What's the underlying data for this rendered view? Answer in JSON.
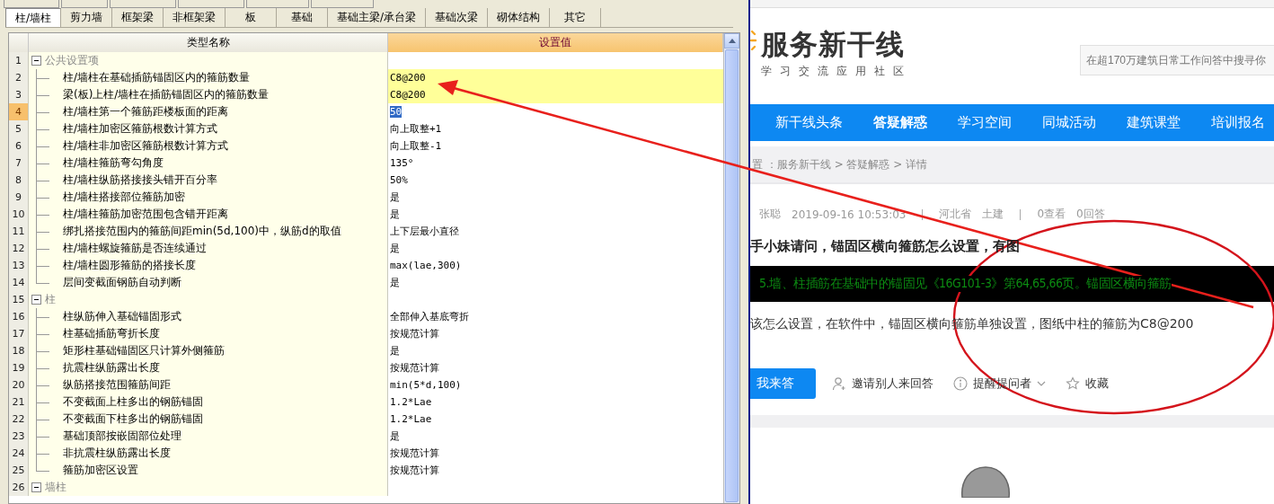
{
  "settings_panel": {
    "category_tabs": [
      {
        "label": "柱/墙柱",
        "selected": true
      },
      {
        "label": "剪力墙",
        "selected": false
      },
      {
        "label": "框架梁",
        "selected": false
      },
      {
        "label": "非框架梁",
        "selected": false
      },
      {
        "label": "板",
        "selected": false
      },
      {
        "label": "基础",
        "selected": false
      },
      {
        "label": "基础主梁/承台梁",
        "selected": false
      },
      {
        "label": "基础次梁",
        "selected": false
      },
      {
        "label": "砌体结构",
        "selected": false
      },
      {
        "label": "其它",
        "selected": false
      }
    ],
    "table": {
      "columns": [
        "类型名称",
        "设置值"
      ],
      "rows": [
        {
          "number": "1",
          "kind": "group",
          "name": "公共设置项",
          "expanded": true,
          "selected": false
        },
        {
          "number": "2",
          "kind": "item",
          "name": "柱/墙柱在基础插筋锚固区内的箍筋数量",
          "value": "C8@200",
          "selected": false,
          "highlighted": true
        },
        {
          "number": "3",
          "kind": "item",
          "name": "梁(板)上柱/墙柱在插筋锚固区内的箍筋数量",
          "value": "C8@200",
          "selected": false,
          "highlighted": true
        },
        {
          "number": "4",
          "kind": "item",
          "name": "柱/墙柱第一个箍筋距楼板面的距离",
          "value": "50",
          "selected": true,
          "highlighted": false
        },
        {
          "number": "5",
          "kind": "item",
          "name": "柱/墙柱加密区箍筋根数计算方式",
          "value": "向上取整+1",
          "selected": false,
          "highlighted": false
        },
        {
          "number": "6",
          "kind": "item",
          "name": "柱/墙柱非加密区箍筋根数计算方式",
          "value": "向上取整-1",
          "selected": false,
          "highlighted": false
        },
        {
          "number": "7",
          "kind": "item",
          "name": "柱/墙柱箍筋弯勾角度",
          "value": "135°",
          "selected": false,
          "highlighted": false
        },
        {
          "number": "8",
          "kind": "item",
          "name": "柱/墙柱纵筋搭接接头错开百分率",
          "value": "50%",
          "selected": false,
          "highlighted": false
        },
        {
          "number": "9",
          "kind": "item",
          "name": "柱/墙柱搭接部位箍筋加密",
          "value": "是",
          "selected": false,
          "highlighted": false
        },
        {
          "number": "10",
          "kind": "item",
          "name": "柱/墙柱箍筋加密范围包含错开距离",
          "value": "是",
          "selected": false,
          "highlighted": false
        },
        {
          "number": "11",
          "kind": "item",
          "name": "绑扎搭接范围内的箍筋间距min(5d,100)中，纵筋d的取值",
          "value": "上下层最小直径",
          "selected": false,
          "highlighted": false
        },
        {
          "number": "12",
          "kind": "item",
          "name": "柱/墙柱螺旋箍筋是否连续通过",
          "value": "是",
          "selected": false,
          "highlighted": false
        },
        {
          "number": "13",
          "kind": "item",
          "name": "柱/墙柱圆形箍筋的搭接长度",
          "value": "max(lae,300)",
          "selected": false,
          "highlighted": false
        },
        {
          "number": "14",
          "kind": "item",
          "name": "层间变截面钢筋自动判断",
          "value": "是",
          "selected": false,
          "highlighted": false
        },
        {
          "number": "15",
          "kind": "group",
          "name": "柱",
          "expanded": true,
          "selected": false
        },
        {
          "number": "16",
          "kind": "item",
          "name": "柱纵筋伸入基础锚固形式",
          "value": "全部伸入基底弯折",
          "selected": false,
          "highlighted": false
        },
        {
          "number": "17",
          "kind": "item",
          "name": "柱基础插筋弯折长度",
          "value": "按规范计算",
          "selected": false,
          "highlighted": false
        },
        {
          "number": "18",
          "kind": "item",
          "name": "矩形柱基础锚固区只计算外侧箍筋",
          "value": "是",
          "selected": false,
          "highlighted": false
        },
        {
          "number": "19",
          "kind": "item",
          "name": "抗震柱纵筋露出长度",
          "value": "按规范计算",
          "selected": false,
          "highlighted": false
        },
        {
          "number": "20",
          "kind": "item",
          "name": "纵筋搭接范围箍筋间距",
          "value": "min(5*d,100)",
          "selected": false,
          "highlighted": false
        },
        {
          "number": "21",
          "kind": "item",
          "name": "不变截面上柱多出的钢筋锚固",
          "value": "1.2*Lae",
          "selected": false,
          "highlighted": false
        },
        {
          "number": "22",
          "kind": "item",
          "name": "不变截面下柱多出的钢筋锚固",
          "value": "1.2*Lae",
          "selected": false,
          "highlighted": false
        },
        {
          "number": "23",
          "kind": "item",
          "name": "基础顶部按嵌固部位处理",
          "value": "是",
          "selected": false,
          "highlighted": false
        },
        {
          "number": "24",
          "kind": "item",
          "name": "非抗震柱纵筋露出长度",
          "value": "按规范计算",
          "selected": false,
          "highlighted": false
        },
        {
          "number": "25",
          "kind": "item",
          "name": "箍筋加密区设置",
          "value": "按规范计算",
          "selected": false,
          "highlighted": false
        },
        {
          "number": "26",
          "kind": "group",
          "name": "墙柱",
          "expanded": true,
          "selected": false
        }
      ]
    }
  },
  "browser": {
    "logo": {
      "title": "服务新干线",
      "subtitle": "学习交流应用社区"
    },
    "search": {
      "placeholder": "在超170万建筑日常工作问答中搜寻你"
    },
    "nav": [
      {
        "label": "新干线头条",
        "selected": false
      },
      {
        "label": "答疑解惑",
        "selected": true
      },
      {
        "label": "学习空间",
        "selected": false
      },
      {
        "label": "同城活动",
        "selected": false
      },
      {
        "label": "建筑课堂",
        "selected": false
      },
      {
        "label": "培训报名",
        "selected": false
      }
    ],
    "breadcrumb": "置 ：服务新干线 > 答疑解惑 > 详情",
    "question": {
      "author": "张聪",
      "time": "2019-09-16 10:53:03",
      "region": "河北省",
      "category": "土建",
      "views": "0查看",
      "answers": "0回答",
      "title": "手小妹请问，锚固区横向箍筋怎么设置，有图",
      "image_text": "5.墙、柱插筋在基础中的锚固见《16G101-3》第64,65,66页。锚固区横向箍筋",
      "body": "该怎么设置，在软件中，锚固区横向箍筋单独设置，图纸中柱的箍筋为C8@200",
      "actions": [
        {
          "kind": "primary",
          "label": "我来答"
        },
        {
          "kind": "invite",
          "label": "邀请别人来回答"
        },
        {
          "kind": "remind",
          "label": "提醒提问者"
        },
        {
          "kind": "favorite",
          "label": "收藏"
        }
      ]
    }
  }
}
